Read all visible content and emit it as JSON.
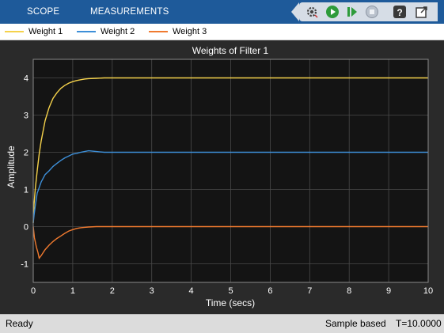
{
  "toolstrip": {
    "tabs": [
      {
        "label": "SCOPE"
      },
      {
        "label": "MEASUREMENTS"
      }
    ],
    "quick_access": [
      {
        "icon": "settings-gear-icon"
      },
      {
        "icon": "run-icon"
      },
      {
        "icon": "step-forward-icon"
      },
      {
        "icon": "stop-icon"
      },
      {
        "icon": "help-icon"
      },
      {
        "icon": "undock-icon"
      }
    ]
  },
  "legend": {
    "items": [
      {
        "label": "Weight 1",
        "color": "#f5d24b"
      },
      {
        "label": "Weight 2",
        "color": "#3d8fd8"
      },
      {
        "label": "Weight 3",
        "color": "#f07a2f"
      }
    ]
  },
  "colors": {
    "axes_bg": "#141414",
    "figure_bg": "#2a2a2a",
    "grid": "#4a4a4a",
    "text": "#ffffff",
    "toolstrip": "#1e5a9a"
  },
  "chart_data": {
    "type": "line",
    "title": "Weights of Filter 1",
    "xlabel": "Time (secs)",
    "ylabel": "Amplitude",
    "xlim": [
      0,
      10
    ],
    "ylim": [
      -1.5,
      4.5
    ],
    "xticks": [
      "0",
      "1",
      "2",
      "3",
      "4",
      "5",
      "6",
      "7",
      "8",
      "9",
      "10"
    ],
    "yticks": [
      "-1",
      "0",
      "1",
      "2",
      "3",
      "4"
    ],
    "grid": true,
    "series": [
      {
        "name": "Weight 1",
        "color": "#f5d24b",
        "x": [
          0,
          0.02,
          0.05,
          0.1,
          0.15,
          0.2,
          0.3,
          0.4,
          0.5,
          0.6,
          0.7,
          0.8,
          0.9,
          1.0,
          1.1,
          1.2,
          1.3,
          1.4,
          1.6,
          1.8,
          2.0,
          2.5,
          3,
          4,
          5,
          6,
          7,
          8,
          9,
          10
        ],
        "y": [
          0.1,
          0.6,
          1.0,
          1.5,
          1.95,
          2.3,
          2.85,
          3.2,
          3.45,
          3.6,
          3.72,
          3.8,
          3.86,
          3.9,
          3.93,
          3.95,
          3.97,
          3.98,
          3.99,
          4.0,
          4.0,
          4.0,
          4.0,
          4.0,
          4.0,
          4.0,
          4.0,
          4.0,
          4.0,
          4.0
        ]
      },
      {
        "name": "Weight 2",
        "color": "#3d8fd8",
        "x": [
          0,
          0.02,
          0.05,
          0.1,
          0.15,
          0.2,
          0.3,
          0.4,
          0.5,
          0.6,
          0.7,
          0.8,
          0.9,
          1.0,
          1.1,
          1.2,
          1.3,
          1.4,
          1.5,
          1.6,
          1.8,
          2.0,
          2.5,
          3,
          4,
          5,
          6,
          7,
          8,
          9,
          10
        ],
        "y": [
          0.1,
          0.3,
          0.55,
          0.9,
          1.05,
          1.2,
          1.4,
          1.5,
          1.62,
          1.7,
          1.78,
          1.85,
          1.9,
          1.95,
          1.97,
          2.0,
          2.02,
          2.04,
          2.03,
          2.02,
          2.0,
          2.0,
          2.0,
          2.0,
          2.0,
          2.0,
          2.0,
          2.0,
          2.0,
          2.0,
          2.0
        ]
      },
      {
        "name": "Weight 3",
        "color": "#f07a2f",
        "x": [
          0,
          0.03,
          0.08,
          0.12,
          0.15,
          0.2,
          0.25,
          0.3,
          0.4,
          0.5,
          0.6,
          0.7,
          0.8,
          0.9,
          1.0,
          1.1,
          1.2,
          1.3,
          1.4,
          1.6,
          1.8,
          2.0,
          2.5,
          3,
          4,
          5,
          6,
          7,
          8,
          9,
          10
        ],
        "y": [
          0.0,
          -0.3,
          -0.55,
          -0.7,
          -0.85,
          -0.78,
          -0.7,
          -0.62,
          -0.5,
          -0.4,
          -0.32,
          -0.25,
          -0.18,
          -0.12,
          -0.08,
          -0.05,
          -0.03,
          -0.02,
          -0.01,
          0.0,
          0.0,
          0.0,
          0.0,
          0.0,
          0.0,
          0.0,
          0.0,
          0.0,
          0.0,
          0.0,
          0.0
        ]
      }
    ]
  },
  "status": {
    "left": "Ready",
    "mode": "Sample based",
    "time": "T=10.0000"
  }
}
